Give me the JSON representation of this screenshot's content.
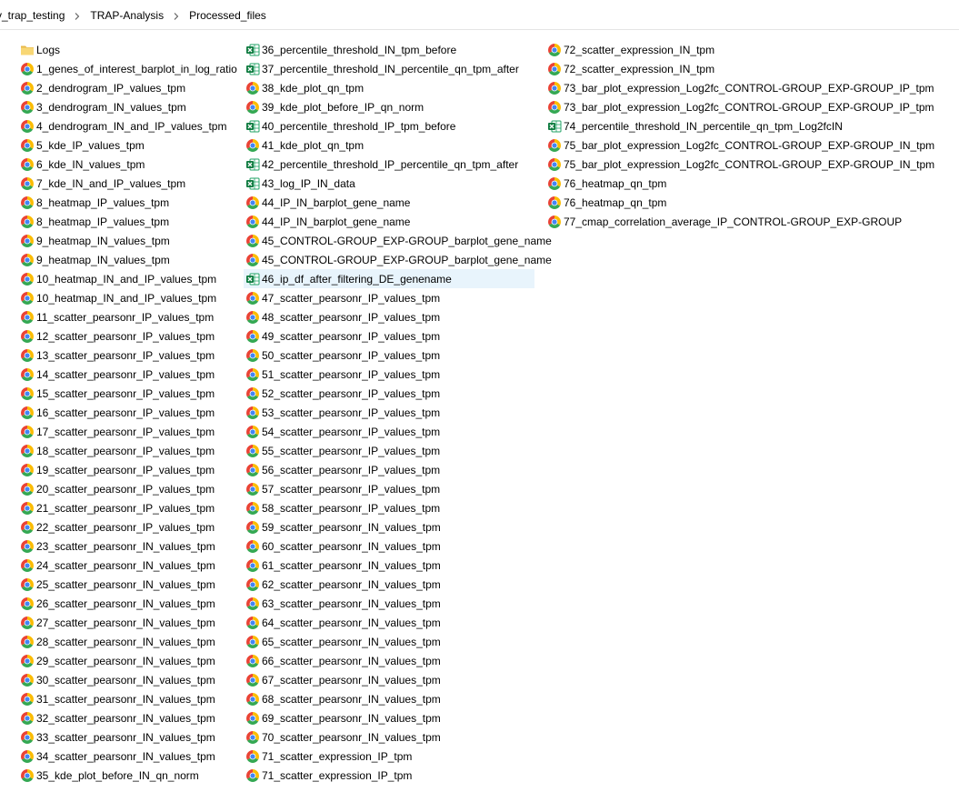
{
  "breadcrumb": [
    "v_trap_testing",
    "TRAP-Analysis",
    "Processed_files"
  ],
  "columns": [
    [
      {
        "name": "Logs",
        "icon": "folder-icon"
      },
      {
        "name": "1_genes_of_interest_barplot_in_log_ratio",
        "icon": "chrome-icon"
      },
      {
        "name": "2_dendrogram_IP_values_tpm",
        "icon": "chrome-icon"
      },
      {
        "name": "3_dendrogram_IN_values_tpm",
        "icon": "chrome-icon"
      },
      {
        "name": "4_dendrogram_IN_and_IP_values_tpm",
        "icon": "chrome-icon"
      },
      {
        "name": "5_kde_IP_values_tpm",
        "icon": "chrome-icon"
      },
      {
        "name": "6_kde_IN_values_tpm",
        "icon": "chrome-icon"
      },
      {
        "name": "7_kde_IN_and_IP_values_tpm",
        "icon": "chrome-icon"
      },
      {
        "name": "8_heatmap_IP_values_tpm",
        "icon": "chrome-icon"
      },
      {
        "name": "8_heatmap_IP_values_tpm",
        "icon": "chrome-icon"
      },
      {
        "name": "9_heatmap_IN_values_tpm",
        "icon": "chrome-icon"
      },
      {
        "name": "9_heatmap_IN_values_tpm",
        "icon": "chrome-icon"
      },
      {
        "name": "10_heatmap_IN_and_IP_values_tpm",
        "icon": "chrome-icon"
      },
      {
        "name": "10_heatmap_IN_and_IP_values_tpm",
        "icon": "chrome-icon"
      },
      {
        "name": "11_scatter_pearsonr_IP_values_tpm",
        "icon": "chrome-icon"
      },
      {
        "name": "12_scatter_pearsonr_IP_values_tpm",
        "icon": "chrome-icon"
      },
      {
        "name": "13_scatter_pearsonr_IP_values_tpm",
        "icon": "chrome-icon"
      },
      {
        "name": "14_scatter_pearsonr_IP_values_tpm",
        "icon": "chrome-icon"
      },
      {
        "name": "15_scatter_pearsonr_IP_values_tpm",
        "icon": "chrome-icon"
      },
      {
        "name": "16_scatter_pearsonr_IP_values_tpm",
        "icon": "chrome-icon"
      },
      {
        "name": "17_scatter_pearsonr_IP_values_tpm",
        "icon": "chrome-icon"
      },
      {
        "name": "18_scatter_pearsonr_IP_values_tpm",
        "icon": "chrome-icon"
      },
      {
        "name": "19_scatter_pearsonr_IP_values_tpm",
        "icon": "chrome-icon"
      },
      {
        "name": "20_scatter_pearsonr_IP_values_tpm",
        "icon": "chrome-icon"
      },
      {
        "name": "21_scatter_pearsonr_IP_values_tpm",
        "icon": "chrome-icon"
      },
      {
        "name": "22_scatter_pearsonr_IP_values_tpm",
        "icon": "chrome-icon"
      },
      {
        "name": "23_scatter_pearsonr_IN_values_tpm",
        "icon": "chrome-icon"
      },
      {
        "name": "24_scatter_pearsonr_IN_values_tpm",
        "icon": "chrome-icon"
      },
      {
        "name": "25_scatter_pearsonr_IN_values_tpm",
        "icon": "chrome-icon"
      },
      {
        "name": "26_scatter_pearsonr_IN_values_tpm",
        "icon": "chrome-icon"
      },
      {
        "name": "27_scatter_pearsonr_IN_values_tpm",
        "icon": "chrome-icon"
      },
      {
        "name": "28_scatter_pearsonr_IN_values_tpm",
        "icon": "chrome-icon"
      },
      {
        "name": "29_scatter_pearsonr_IN_values_tpm",
        "icon": "chrome-icon"
      },
      {
        "name": "30_scatter_pearsonr_IN_values_tpm",
        "icon": "chrome-icon"
      },
      {
        "name": "31_scatter_pearsonr_IN_values_tpm",
        "icon": "chrome-icon"
      },
      {
        "name": "32_scatter_pearsonr_IN_values_tpm",
        "icon": "chrome-icon"
      },
      {
        "name": "33_scatter_pearsonr_IN_values_tpm",
        "icon": "chrome-icon"
      },
      {
        "name": "34_scatter_pearsonr_IN_values_tpm",
        "icon": "chrome-icon"
      },
      {
        "name": "35_kde_plot_before_IN_qn_norm",
        "icon": "chrome-icon"
      }
    ],
    [
      {
        "name": "36_percentile_threshold_IN_tpm_before",
        "icon": "excel-icon"
      },
      {
        "name": "37_percentile_threshold_IN_percentile_qn_tpm_after",
        "icon": "excel-icon"
      },
      {
        "name": "38_kde_plot_qn_tpm",
        "icon": "chrome-icon"
      },
      {
        "name": "39_kde_plot_before_IP_qn_norm",
        "icon": "chrome-icon"
      },
      {
        "name": "40_percentile_threshold_IP_tpm_before",
        "icon": "excel-icon"
      },
      {
        "name": "41_kde_plot_qn_tpm",
        "icon": "chrome-icon"
      },
      {
        "name": "42_percentile_threshold_IP_percentile_qn_tpm_after",
        "icon": "excel-icon"
      },
      {
        "name": "43_log_IP_IN_data",
        "icon": "excel-icon"
      },
      {
        "name": "44_IP_IN_barplot_gene_name",
        "icon": "chrome-icon"
      },
      {
        "name": "44_IP_IN_barplot_gene_name",
        "icon": "chrome-icon"
      },
      {
        "name": "45_CONTROL-GROUP_EXP-GROUP_barplot_gene_name",
        "icon": "chrome-icon"
      },
      {
        "name": "45_CONTROL-GROUP_EXP-GROUP_barplot_gene_name",
        "icon": "chrome-icon"
      },
      {
        "name": "46_ip_df_after_filtering_DE_genename",
        "icon": "excel-icon",
        "selected": true
      },
      {
        "name": "47_scatter_pearsonr_IP_values_tpm",
        "icon": "chrome-icon"
      },
      {
        "name": "48_scatter_pearsonr_IP_values_tpm",
        "icon": "chrome-icon"
      },
      {
        "name": "49_scatter_pearsonr_IP_values_tpm",
        "icon": "chrome-icon"
      },
      {
        "name": "50_scatter_pearsonr_IP_values_tpm",
        "icon": "chrome-icon"
      },
      {
        "name": "51_scatter_pearsonr_IP_values_tpm",
        "icon": "chrome-icon"
      },
      {
        "name": "52_scatter_pearsonr_IP_values_tpm",
        "icon": "chrome-icon"
      },
      {
        "name": "53_scatter_pearsonr_IP_values_tpm",
        "icon": "chrome-icon"
      },
      {
        "name": "54_scatter_pearsonr_IP_values_tpm",
        "icon": "chrome-icon"
      },
      {
        "name": "55_scatter_pearsonr_IP_values_tpm",
        "icon": "chrome-icon"
      },
      {
        "name": "56_scatter_pearsonr_IP_values_tpm",
        "icon": "chrome-icon"
      },
      {
        "name": "57_scatter_pearsonr_IP_values_tpm",
        "icon": "chrome-icon"
      },
      {
        "name": "58_scatter_pearsonr_IP_values_tpm",
        "icon": "chrome-icon"
      },
      {
        "name": "59_scatter_pearsonr_IN_values_tpm",
        "icon": "chrome-icon"
      },
      {
        "name": "60_scatter_pearsonr_IN_values_tpm",
        "icon": "chrome-icon"
      },
      {
        "name": "61_scatter_pearsonr_IN_values_tpm",
        "icon": "chrome-icon"
      },
      {
        "name": "62_scatter_pearsonr_IN_values_tpm",
        "icon": "chrome-icon"
      },
      {
        "name": "63_scatter_pearsonr_IN_values_tpm",
        "icon": "chrome-icon"
      },
      {
        "name": "64_scatter_pearsonr_IN_values_tpm",
        "icon": "chrome-icon"
      },
      {
        "name": "65_scatter_pearsonr_IN_values_tpm",
        "icon": "chrome-icon"
      },
      {
        "name": "66_scatter_pearsonr_IN_values_tpm",
        "icon": "chrome-icon"
      },
      {
        "name": "67_scatter_pearsonr_IN_values_tpm",
        "icon": "chrome-icon"
      },
      {
        "name": "68_scatter_pearsonr_IN_values_tpm",
        "icon": "chrome-icon"
      },
      {
        "name": "69_scatter_pearsonr_IN_values_tpm",
        "icon": "chrome-icon"
      },
      {
        "name": "70_scatter_pearsonr_IN_values_tpm",
        "icon": "chrome-icon"
      },
      {
        "name": "71_scatter_expression_IP_tpm",
        "icon": "chrome-icon"
      },
      {
        "name": "71_scatter_expression_IP_tpm",
        "icon": "chrome-icon"
      }
    ],
    [
      {
        "name": "72_scatter_expression_IN_tpm",
        "icon": "chrome-icon"
      },
      {
        "name": "72_scatter_expression_IN_tpm",
        "icon": "chrome-icon"
      },
      {
        "name": "73_bar_plot_expression_Log2fc_CONTROL-GROUP_EXP-GROUP_IP_tpm",
        "icon": "chrome-icon"
      },
      {
        "name": "73_bar_plot_expression_Log2fc_CONTROL-GROUP_EXP-GROUP_IP_tpm",
        "icon": "chrome-icon"
      },
      {
        "name": "74_percentile_threshold_IN_percentile_qn_tpm_Log2fcIN",
        "icon": "excel-icon"
      },
      {
        "name": "75_bar_plot_expression_Log2fc_CONTROL-GROUP_EXP-GROUP_IN_tpm",
        "icon": "chrome-icon"
      },
      {
        "name": "75_bar_plot_expression_Log2fc_CONTROL-GROUP_EXP-GROUP_IN_tpm",
        "icon": "chrome-icon"
      },
      {
        "name": "76_heatmap_qn_tpm",
        "icon": "chrome-icon"
      },
      {
        "name": "76_heatmap_qn_tpm",
        "icon": "chrome-icon"
      },
      {
        "name": "77_cmap_correlation_average_IP_CONTROL-GROUP_EXP-GROUP",
        "icon": "chrome-icon"
      }
    ]
  ]
}
